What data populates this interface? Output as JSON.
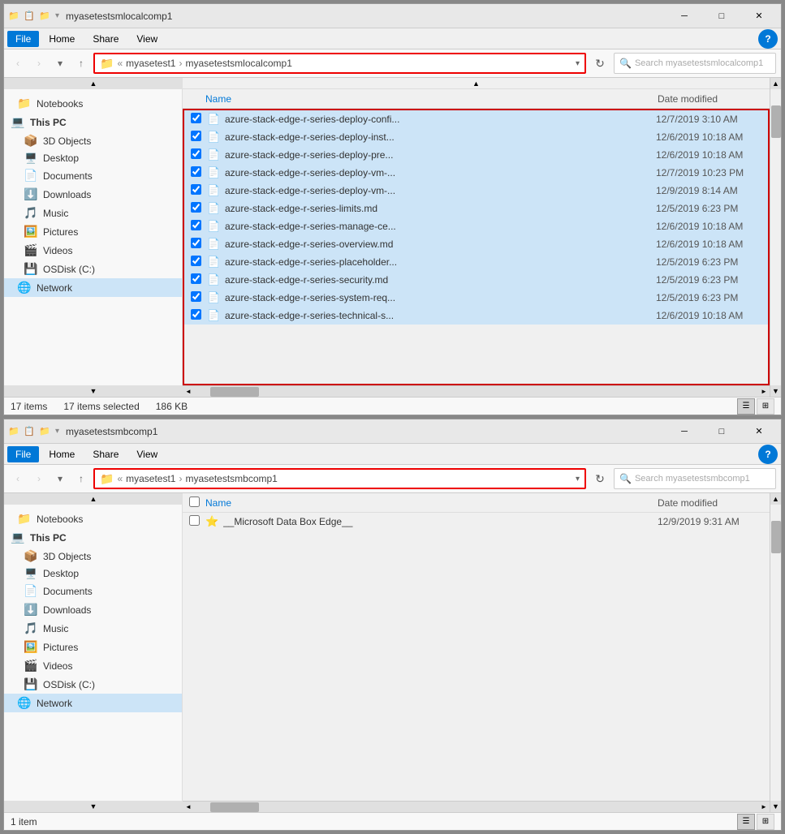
{
  "window1": {
    "title": "myasetestsmlocalcomp1",
    "titlebar_icons": [
      "📁",
      "📋",
      "📁"
    ],
    "menus": [
      "File",
      "Home",
      "Share",
      "View"
    ],
    "active_menu": "Home",
    "address": {
      "folder_icon": "📁",
      "path1": "myasetest1",
      "separator": ">",
      "path2": "myasetestsmlocalcomp1"
    },
    "search_placeholder": "Search myasetestsmlocalcomp1",
    "help_label": "?",
    "sidebar": {
      "items": [
        {
          "label": "Notebooks",
          "icon": "📁",
          "indent": 0
        },
        {
          "label": "This PC",
          "icon": "💻",
          "indent": 0
        },
        {
          "label": "3D Objects",
          "icon": "📦",
          "indent": 1
        },
        {
          "label": "Desktop",
          "icon": "🖥️",
          "indent": 1
        },
        {
          "label": "Documents",
          "icon": "📄",
          "indent": 1
        },
        {
          "label": "Downloads",
          "icon": "⬇️",
          "indent": 1
        },
        {
          "label": "Music",
          "icon": "🎵",
          "indent": 1
        },
        {
          "label": "Pictures",
          "icon": "🖼️",
          "indent": 1
        },
        {
          "label": "Videos",
          "icon": "🎬",
          "indent": 1
        },
        {
          "label": "OSDisk (C:)",
          "icon": "💾",
          "indent": 1
        },
        {
          "label": "Network",
          "icon": "🌐",
          "indent": 0,
          "active": true
        }
      ]
    },
    "file_list": {
      "columns": [
        "Name",
        "Date modified"
      ],
      "files": [
        {
          "name": "azure-stack-edge-r-series-deploy-confi...",
          "date": "12/7/2019 3:10 AM",
          "selected": true,
          "checked": true
        },
        {
          "name": "azure-stack-edge-r-series-deploy-inst...",
          "date": "12/6/2019 10:18 AM",
          "selected": true,
          "checked": true
        },
        {
          "name": "azure-stack-edge-r-series-deploy-pre...",
          "date": "12/6/2019 10:18 AM",
          "selected": true,
          "checked": true
        },
        {
          "name": "azure-stack-edge-r-series-deploy-vm-...",
          "date": "12/7/2019 10:23 PM",
          "selected": true,
          "checked": true
        },
        {
          "name": "azure-stack-edge-r-series-deploy-vm-...",
          "date": "12/9/2019 8:14 AM",
          "selected": true,
          "checked": true
        },
        {
          "name": "azure-stack-edge-r-series-limits.md",
          "date": "12/5/2019 6:23 PM",
          "selected": true,
          "checked": true
        },
        {
          "name": "azure-stack-edge-r-series-manage-ce...",
          "date": "12/6/2019 10:18 AM",
          "selected": true,
          "checked": true
        },
        {
          "name": "azure-stack-edge-r-series-overview.md",
          "date": "12/6/2019 10:18 AM",
          "selected": true,
          "checked": true
        },
        {
          "name": "azure-stack-edge-r-series-placeholder...",
          "date": "12/5/2019 6:23 PM",
          "selected": true,
          "checked": true
        },
        {
          "name": "azure-stack-edge-r-series-security.md",
          "date": "12/5/2019 6:23 PM",
          "selected": true,
          "checked": true
        },
        {
          "name": "azure-stack-edge-r-series-system-req...",
          "date": "12/5/2019 6:23 PM",
          "selected": true,
          "checked": true
        },
        {
          "name": "azure-stack-edge-r-series-technical-s...",
          "date": "12/6/2019 10:18 AM",
          "selected": true,
          "checked": true
        }
      ]
    },
    "status": {
      "count": "17 items",
      "selected": "17 items selected",
      "size": "186 KB"
    }
  },
  "window2": {
    "title": "myasetestsmbcomp1",
    "titlebar_icons": [
      "📁",
      "📋",
      "📁"
    ],
    "menus": [
      "File",
      "Home",
      "Share",
      "View"
    ],
    "active_menu": "Home",
    "address": {
      "folder_icon": "📁",
      "path1": "myasetest1",
      "separator": ">",
      "path2": "myasetestsmbcomp1"
    },
    "search_placeholder": "Search myasetestsmbcomp1",
    "help_label": "?",
    "sidebar": {
      "items": [
        {
          "label": "Notebooks",
          "icon": "📁",
          "indent": 0
        },
        {
          "label": "This PC",
          "icon": "💻",
          "indent": 0
        },
        {
          "label": "3D Objects",
          "icon": "📦",
          "indent": 1
        },
        {
          "label": "Desktop",
          "icon": "🖥️",
          "indent": 1
        },
        {
          "label": "Documents",
          "icon": "📄",
          "indent": 1
        },
        {
          "label": "Downloads",
          "icon": "⬇️",
          "indent": 1
        },
        {
          "label": "Music",
          "icon": "🎵",
          "indent": 1
        },
        {
          "label": "Pictures",
          "icon": "🖼️",
          "indent": 1
        },
        {
          "label": "Videos",
          "icon": "🎬",
          "indent": 1
        },
        {
          "label": "OSDisk (C:)",
          "icon": "💾",
          "indent": 1
        },
        {
          "label": "Network",
          "icon": "🌐",
          "indent": 0,
          "active": true
        }
      ]
    },
    "file_list": {
      "columns": [
        "Name",
        "Date modified"
      ],
      "files": [
        {
          "name": "__Microsoft Data Box Edge__",
          "date": "12/9/2019 9:31 AM",
          "selected": false,
          "checked": false,
          "special_icon": "⭐"
        }
      ]
    },
    "status": {
      "count": "1 item",
      "selected": "",
      "size": ""
    }
  },
  "icons": {
    "back": "‹",
    "forward": "›",
    "up": "↑",
    "refresh": "↻",
    "search": "🔍",
    "dropdown": "▾",
    "minimize": "─",
    "maximize": "□",
    "close": "✕",
    "scroll_up": "▲",
    "scroll_down": "▼",
    "scroll_left": "◄",
    "scroll_right": "►",
    "file": "📄",
    "view_details": "☰",
    "view_large": "⊞"
  }
}
